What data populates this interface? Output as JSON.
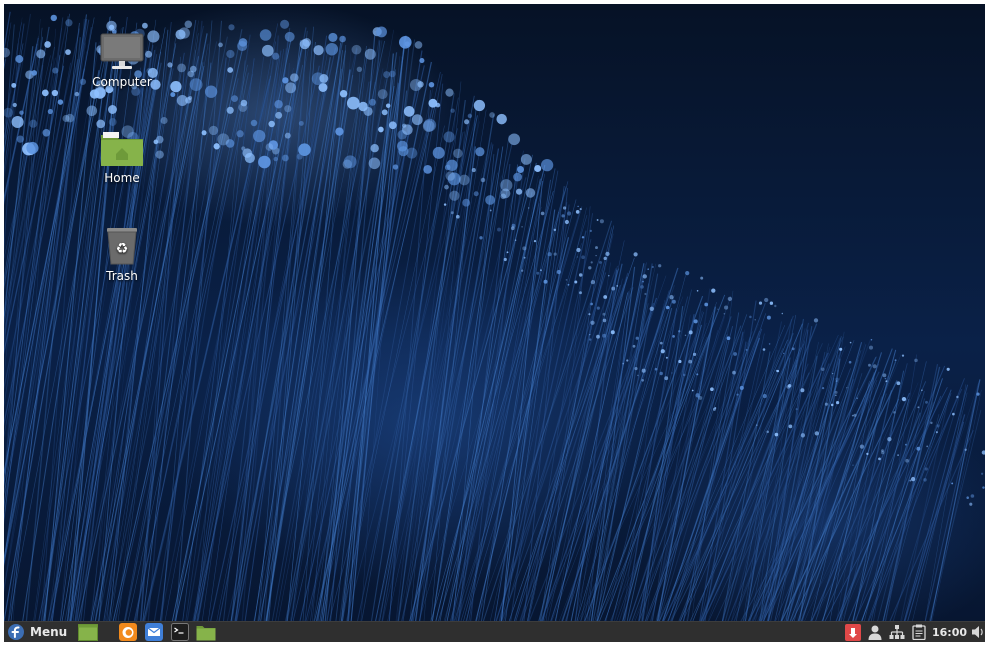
{
  "desktop": {
    "icons": [
      {
        "label": "Computer",
        "icon": "monitor-icon"
      },
      {
        "label": "Home",
        "icon": "home-folder-icon"
      },
      {
        "label": "Trash",
        "icon": "trash-icon"
      }
    ]
  },
  "taskbar": {
    "menu_label": "Menu",
    "launchers": [
      "show-desktop-icon",
      "firefox-icon",
      "mail-icon",
      "terminal-icon",
      "folder-icon"
    ],
    "tray": [
      "update-notifier-icon",
      "user-icon",
      "network-icon",
      "clipboard-icon",
      "volume-icon"
    ],
    "clock": "16:00"
  },
  "colors": {
    "taskbar_bg": "#2f2f2f",
    "folder_green": "#86b34a",
    "firefox_orange": "#f28a1c",
    "mail_blue": "#3f7fd8",
    "fedora_blue": "#3c6eb4",
    "notifier_red": "#e04848"
  }
}
